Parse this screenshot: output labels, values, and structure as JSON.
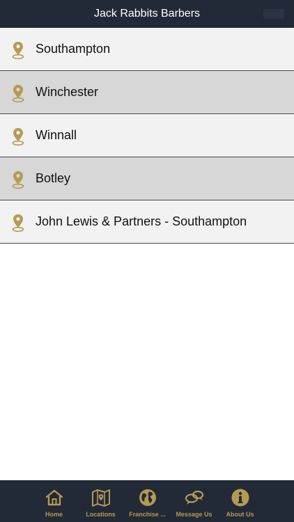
{
  "header": {
    "title": "Jack Rabbits Barbers"
  },
  "colors": {
    "nav_background": "#222a37",
    "accent_gold": "#b59a52",
    "row_light": "#f2f2f2",
    "row_dark": "#d7d7d7"
  },
  "locations": [
    {
      "label": "Southampton",
      "icon": "map-pin-icon"
    },
    {
      "label": "Winchester",
      "icon": "map-pin-icon"
    },
    {
      "label": "Winnall",
      "icon": "map-pin-icon"
    },
    {
      "label": "Botley",
      "icon": "map-pin-icon"
    },
    {
      "label": "John Lewis & Partners - Southampton",
      "icon": "map-pin-icon"
    }
  ],
  "tabbar": {
    "tabs": [
      {
        "label": "Home",
        "icon": "home-icon"
      },
      {
        "label": "Locations",
        "icon": "map-icon"
      },
      {
        "label": "Franchise ...",
        "icon": "globe-icon"
      },
      {
        "label": "Message Us",
        "icon": "chat-bubbles-icon"
      },
      {
        "label": "About Us",
        "icon": "info-icon"
      }
    ]
  }
}
